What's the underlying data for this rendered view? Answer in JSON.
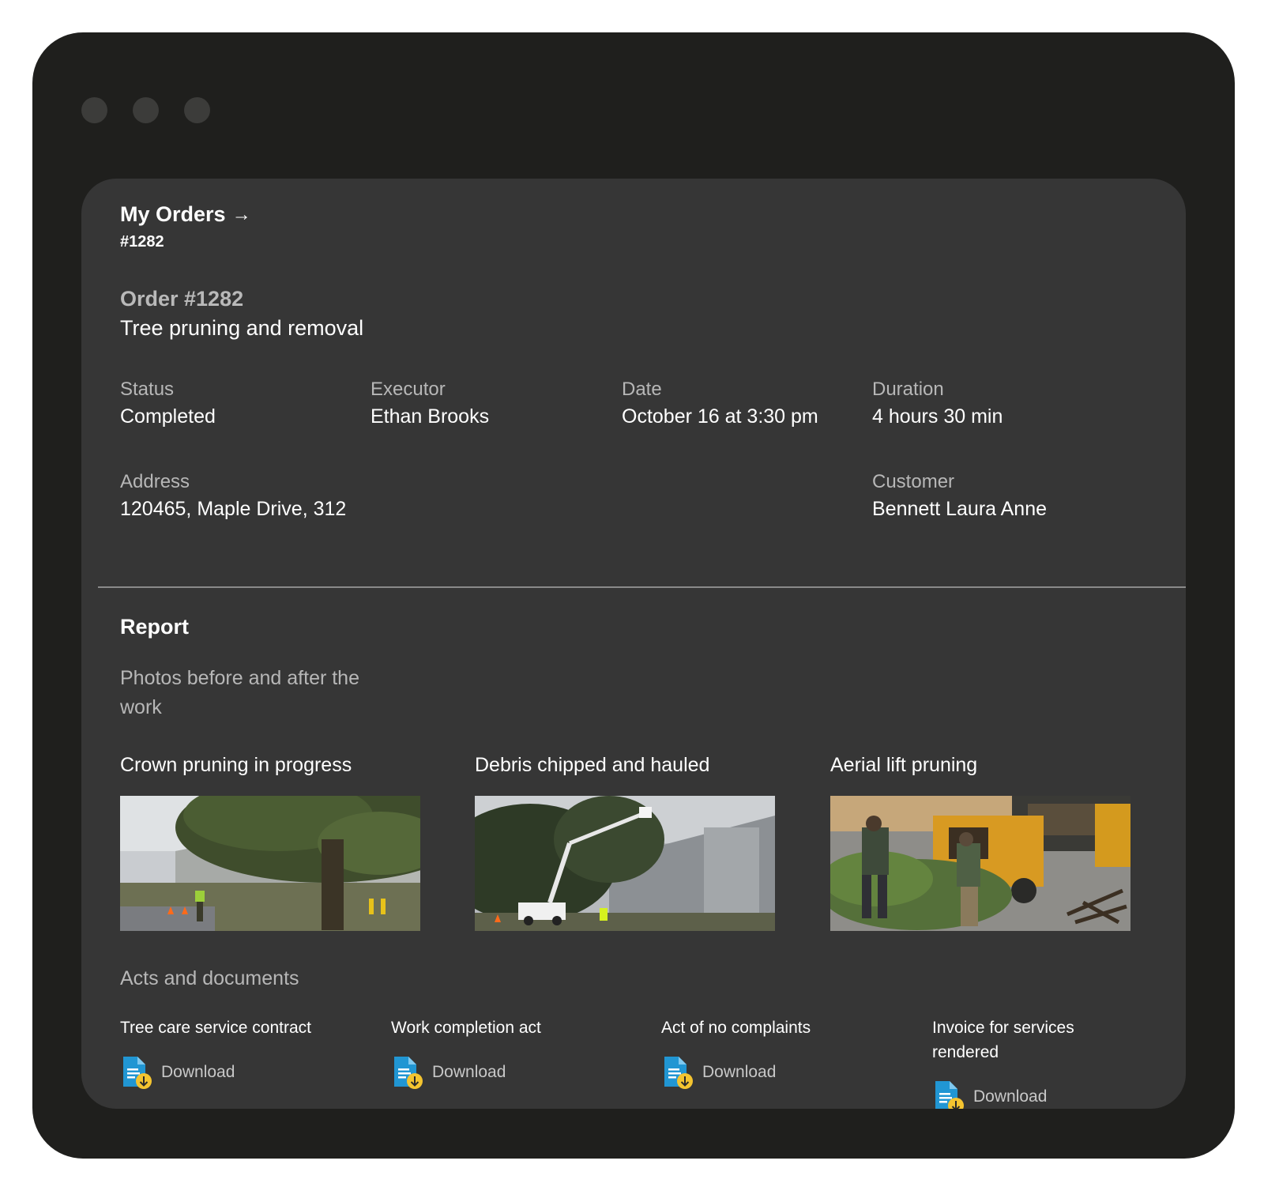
{
  "breadcrumb": {
    "link": "My Orders",
    "arrow": "→",
    "current": "#1282"
  },
  "order": {
    "number_label": "Order #1282",
    "title": "Tree pruning and removal"
  },
  "fields": {
    "status": {
      "label": "Status",
      "value": "Completed"
    },
    "executor": {
      "label": "Executor",
      "value": "Ethan Brooks"
    },
    "date": {
      "label": "Date",
      "value": "October 16 at 3:30 pm"
    },
    "duration": {
      "label": "Duration",
      "value": "4 hours 30 min"
    },
    "address": {
      "label": "Address",
      "value": "120465, Maple Drive, 312"
    },
    "customer": {
      "label": "Customer",
      "value": "Bennett Laura Anne"
    }
  },
  "report": {
    "title": "Report",
    "photos_label": "Photos before and after the work",
    "photos": [
      {
        "caption": "Crown pruning in progress"
      },
      {
        "caption": "Debris chipped and hauled"
      },
      {
        "caption": "Aerial lift pruning"
      }
    ],
    "acts_label": "Acts and documents",
    "documents": [
      {
        "title": "Tree care service contract",
        "action": "Download"
      },
      {
        "title": "Work completion act",
        "action": "Download"
      },
      {
        "title": "Act of no complaints",
        "action": "Download"
      },
      {
        "title": "Invoice for services rendered",
        "action": "Download"
      }
    ]
  },
  "colors": {
    "outer_frame": "#1f1f1d",
    "panel": "#363636",
    "doc_icon_blue": "#2196d3",
    "doc_icon_yellow": "#f4c430"
  },
  "icons": {
    "document_download": "file-download-icon",
    "arrow": "arrow-right-icon"
  }
}
